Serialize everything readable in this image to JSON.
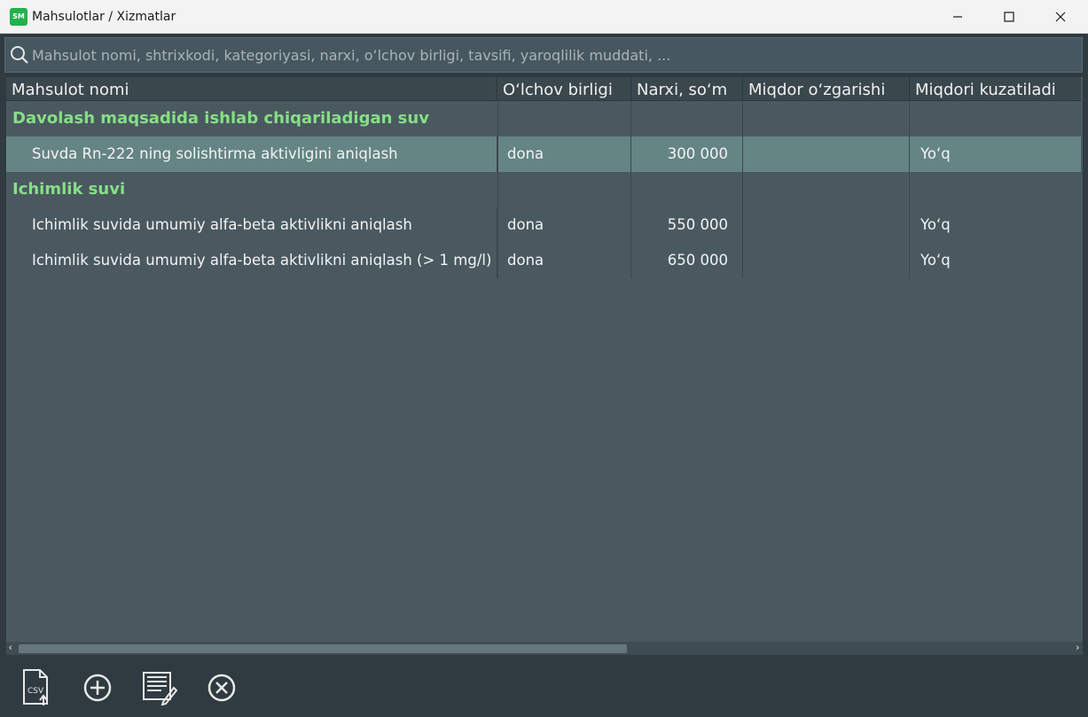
{
  "window": {
    "title": "Mahsulotlar / Xizmatlar",
    "icon_text": "SM"
  },
  "search": {
    "placeholder": "Mahsulot nomi, shtrixkodi, kategoriyasi, narxi, oʻlchov birligi, tavsifi, yaroqlilik muddati, ..."
  },
  "columns": [
    "Mahsulot nomi",
    "Oʻlchov birligi",
    "Narxi, soʻm",
    "Miqdor oʻzgarishi",
    "Miqdori kuzatiladi"
  ],
  "groups": [
    {
      "title": "Davolash maqsadida ishlab chiqariladigan suv",
      "items": [
        {
          "name": "Suvda Rn-222 ning solishtirma aktivligini aniqlash",
          "unit": "dona",
          "price": "300 000",
          "change": "",
          "tracked": "Yoʻq",
          "selected": true
        }
      ]
    },
    {
      "title": "Ichimlik suvi",
      "items": [
        {
          "name": "Ichimlik suvida umumiy alfa-beta aktivlikni aniqlash",
          "unit": "dona",
          "price": "550 000",
          "change": "",
          "tracked": "Yoʻq",
          "selected": false
        },
        {
          "name": "Ichimlik suvida umumiy alfa-beta aktivlikni aniqlash (> 1 mg/l)",
          "unit": "dona",
          "price": "650 000",
          "change": "",
          "tracked": "Yoʻq",
          "selected": false
        }
      ]
    }
  ],
  "toolbar": {
    "buttons": [
      "csv-export-icon",
      "add-circle-icon",
      "edit-list-icon",
      "delete-circle-icon"
    ],
    "csv_label": "CSV"
  },
  "colors": {
    "group_title": "#86df85",
    "selected_row": "#658584",
    "grid_bg": "#4a5960"
  }
}
